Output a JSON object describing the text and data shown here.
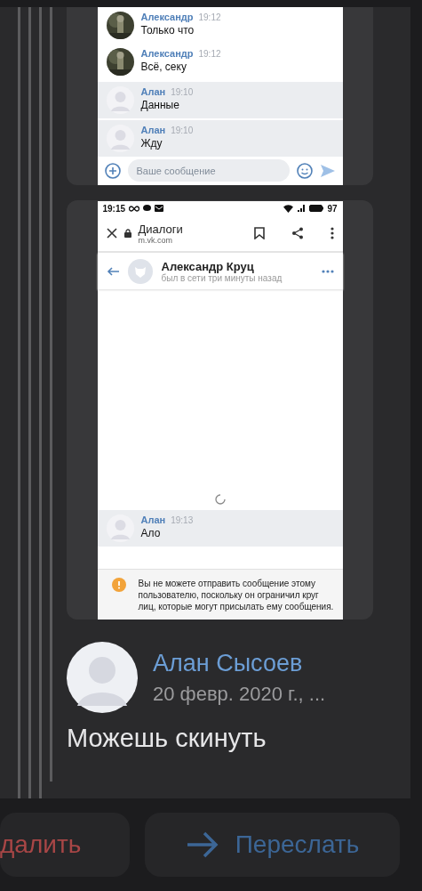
{
  "attachments": [
    {
      "kind": "chat_tail",
      "messages": [
        {
          "kind": "incoming",
          "author": "Александр",
          "time": "19:12",
          "text": "Только что"
        },
        {
          "kind": "incoming",
          "author": "Александр",
          "time": "19:12",
          "text": "Всё, секу"
        },
        {
          "kind": "outgoing",
          "author": "Алан",
          "time": "19:10",
          "text": "Данные"
        },
        {
          "kind": "outgoing",
          "author": "Алан",
          "time": "19:10",
          "text": "Жду"
        }
      ],
      "composer": {
        "placeholder": "Ваше сообщение"
      }
    },
    {
      "kind": "dialog",
      "status_bar": {
        "time": "19:15",
        "battery": "97"
      },
      "browser": {
        "title": "Диалоги",
        "url": "m.vk.com"
      },
      "header": {
        "name": "Александр Круц",
        "status": "был в сети три минуты назад"
      },
      "loading": true,
      "messages": [
        {
          "kind": "outgoing",
          "author": "Алан",
          "time": "19:13",
          "text": "Ало"
        }
      ],
      "notice": "Вы не можете отправить сообщение этому пользователю, поскольку он ограничил круг лиц, которые могут присылать ему сообщения."
    }
  ],
  "message": {
    "author": "Алан Сысоев",
    "date": "20 февр. 2020 г., ...",
    "text": "Можешь скинуть"
  },
  "actions": [
    {
      "kind": "delete",
      "label": "далить"
    },
    {
      "kind": "forward",
      "label": "Переслать"
    }
  ]
}
